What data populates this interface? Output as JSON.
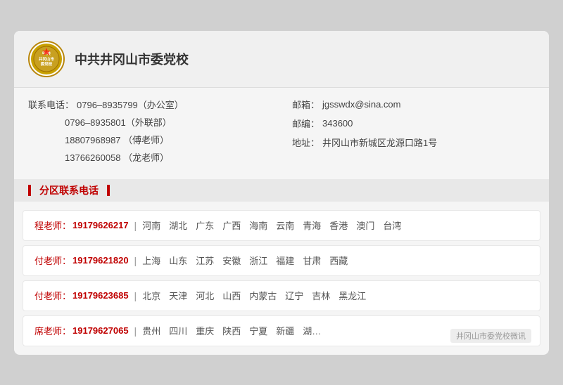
{
  "org": {
    "logo_text": "中共井冈山市委党校",
    "title": "中共井冈山市委党校"
  },
  "contact_info": {
    "phone_label": "联系电话：",
    "phone1_value": "0796–8935799（办公室）",
    "phone2_value": "0796–8935801（外联部）",
    "phone3_value": "18807968987 （傅老师）",
    "phone4_value": "13766260058 （龙老师）",
    "email_label": "邮箱：",
    "email_value": "jgsswdx@sina.com",
    "postcode_label": "邮编：",
    "postcode_value": "343600",
    "address_label": "地址：",
    "address_value": "井冈山市新城区龙源口路1号"
  },
  "section_title": "分区联系电话",
  "contacts": [
    {
      "name": "程老师：",
      "phone": "19179626217",
      "separator": "|",
      "regions": [
        "河南",
        "湖北",
        "广东",
        "广西",
        "海南",
        "云南",
        "青海",
        "香港",
        "澳门",
        "台湾"
      ]
    },
    {
      "name": "付老师：",
      "phone": "19179621820",
      "separator": "|",
      "regions": [
        "上海",
        "山东",
        "江苏",
        "安徽",
        "浙江",
        "福建",
        "甘肃",
        "西藏"
      ]
    },
    {
      "name": "付老师：",
      "phone": "19179623685",
      "separator": "|",
      "regions": [
        "北京",
        "天津",
        "河北",
        "山西",
        "内蒙古",
        "辽宁",
        "吉林",
        "黑龙江"
      ]
    },
    {
      "name": "席老师：",
      "phone": "19179627065",
      "separator": "|",
      "regions": [
        "贵州",
        "四川",
        "重庆",
        "陕西",
        "宁夏",
        "新疆",
        "湖…"
      ]
    }
  ],
  "watermark": "井冈山市委党校微讯"
}
